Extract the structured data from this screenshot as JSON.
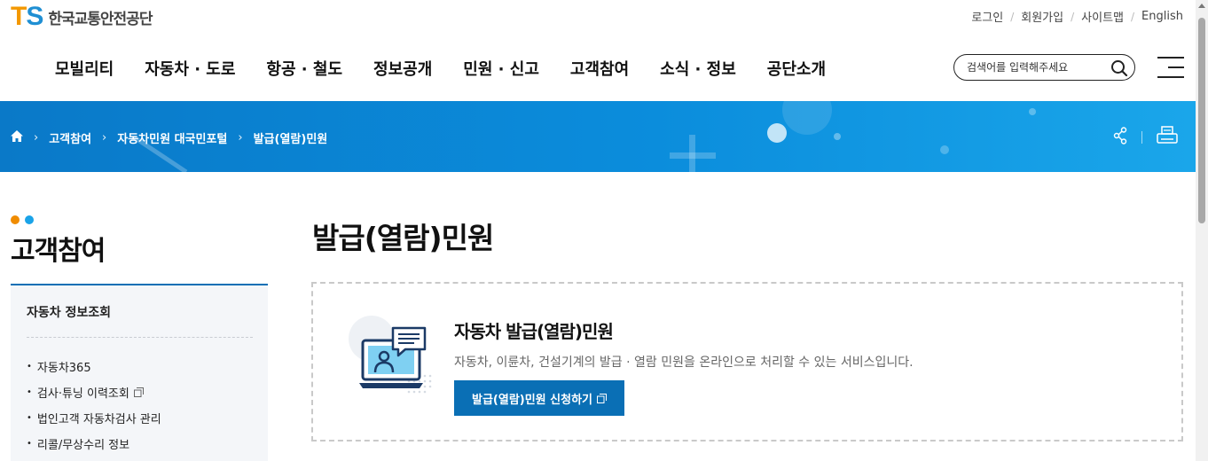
{
  "logo": {
    "mark_t": "T",
    "mark_s": "S",
    "text": "한국교통안전공단"
  },
  "util_nav": [
    "로그인",
    "회원가입",
    "사이트맵",
    "English"
  ],
  "gnb": [
    "모빌리티",
    "자동차 · 도로",
    "항공 · 철도",
    "정보공개",
    "민원 · 신고",
    "고객참여",
    "소식 · 정보",
    "공단소개"
  ],
  "search": {
    "placeholder": "검색어를 입력해주세요"
  },
  "breadcrumb": [
    "고객참여",
    "자동차민원 대국민포털",
    "발급(열람)민원"
  ],
  "sidebar": {
    "title": "고객참여",
    "section": "자동차 정보조회",
    "items": [
      {
        "label": "자동차365",
        "external": false
      },
      {
        "label": "검사·튜닝 이력조회",
        "external": true
      },
      {
        "label": "법인고객 자동차검사 관리",
        "external": false
      },
      {
        "label": "리콜/무상수리 정보",
        "external": false
      }
    ]
  },
  "main": {
    "title": "발급(열람)민원",
    "card": {
      "title": "자동차 발급(열람)민원",
      "description": "자동차, 이륜차, 건설기계의 발급 · 열람 민원을 온라인으로 처리할 수 있는 서비스입니다.",
      "button_label": "발급(열람)민원 신청하기"
    }
  },
  "colors": {
    "accent": "#0a6fb5",
    "logo_orange": "#f39800",
    "logo_blue": "#1f8fd3",
    "dot_orange": "#f08c00",
    "dot_blue": "#1aa3e8"
  },
  "icons": [
    "home-icon",
    "search-icon",
    "menu-icon",
    "share-icon",
    "print-icon",
    "external-link-icon"
  ]
}
